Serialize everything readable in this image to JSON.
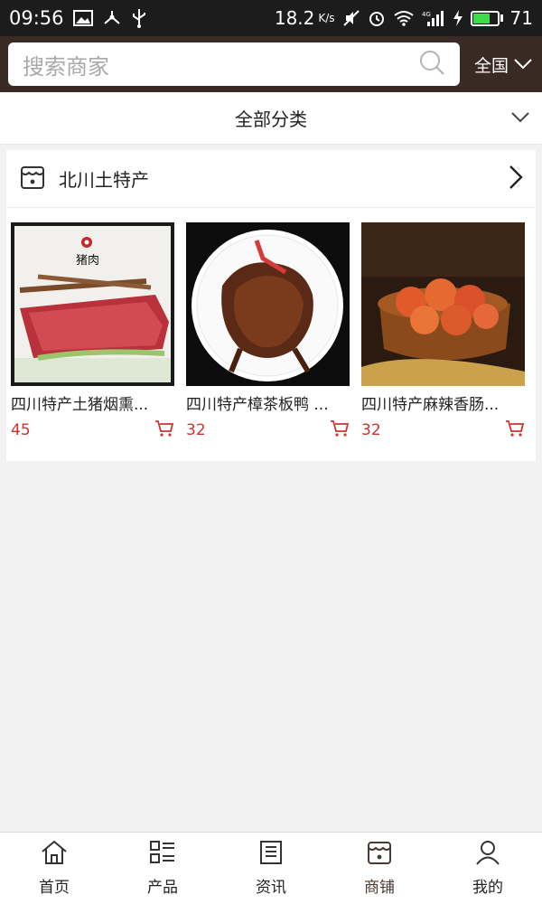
{
  "status_bar": {
    "time": "09:56",
    "speed": "18.2",
    "speed_unit": "K/s",
    "battery": "71",
    "battery_level": 0.71,
    "icons": [
      "image-icon",
      "usb-tether-icon",
      "usb-icon",
      "mute-icon",
      "alarm-icon",
      "wifi-icon",
      "signal-4g-icon",
      "charging-icon",
      "battery-icon"
    ]
  },
  "search": {
    "placeholder": "搜索商家",
    "region": "全国"
  },
  "category": {
    "title": "全部分类"
  },
  "shop": {
    "name": "北川土特产",
    "products": [
      {
        "title": "四川特产土猪烟熏...",
        "price": "45",
        "image_label": "猪肉"
      },
      {
        "title": "四川特产樟茶板鸭 ...",
        "price": "32"
      },
      {
        "title": "四川特产麻辣香肠...",
        "price": "32"
      }
    ]
  },
  "nav": {
    "items": [
      {
        "label": "首页",
        "icon": "home-icon"
      },
      {
        "label": "产品",
        "icon": "product-list-icon"
      },
      {
        "label": "资讯",
        "icon": "news-icon"
      },
      {
        "label": "商铺",
        "icon": "shop-icon",
        "active": true
      },
      {
        "label": "我的",
        "icon": "user-icon"
      }
    ]
  },
  "colors": {
    "header_bg": "#3a2a24",
    "price": "#d0302f",
    "battery_fill": "#3ddc4b"
  }
}
